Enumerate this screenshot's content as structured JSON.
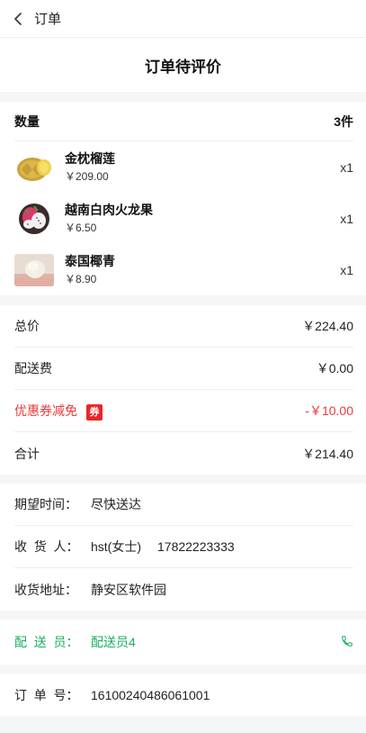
{
  "header": {
    "title": "订单"
  },
  "status": {
    "text": "订单待评价"
  },
  "goods": {
    "qty_label": "数量",
    "qty_value": "3件",
    "items": [
      {
        "name": "金枕榴莲",
        "price": "￥209.00",
        "count": "x1",
        "image": "durian"
      },
      {
        "name": "越南白肉火龙果",
        "price": "￥6.50",
        "count": "x1",
        "image": "dragon-fruit"
      },
      {
        "name": "泰国椰青",
        "price": "￥8.90",
        "count": "x1",
        "image": "coconut"
      }
    ]
  },
  "costs": {
    "total_label": "总价",
    "total_value": "￥224.40",
    "delivery_label": "配送费",
    "delivery_value": "￥0.00",
    "coupon_label": "优惠券减免",
    "coupon_badge": "券",
    "coupon_value": "-￥10.00",
    "sum_label": "合计",
    "sum_value": "￥214.40"
  },
  "delivery": {
    "time_label": "期望时间：",
    "time_value": "尽快送达",
    "receiver_label": "收  货  人：",
    "receiver_name": "hst(女士)",
    "receiver_phone": "17822223333",
    "address_label": "收货地址：",
    "address_value": "静安区软件园"
  },
  "courier": {
    "label": "配  送  员：",
    "name": "配送员4",
    "icon": "phone-icon"
  },
  "order": {
    "no_label": "订  单  号：",
    "no_value": "16100240486061001"
  },
  "colors": {
    "green": "#1aad61",
    "red": "#e83a3a",
    "badge": "#e8262b"
  }
}
